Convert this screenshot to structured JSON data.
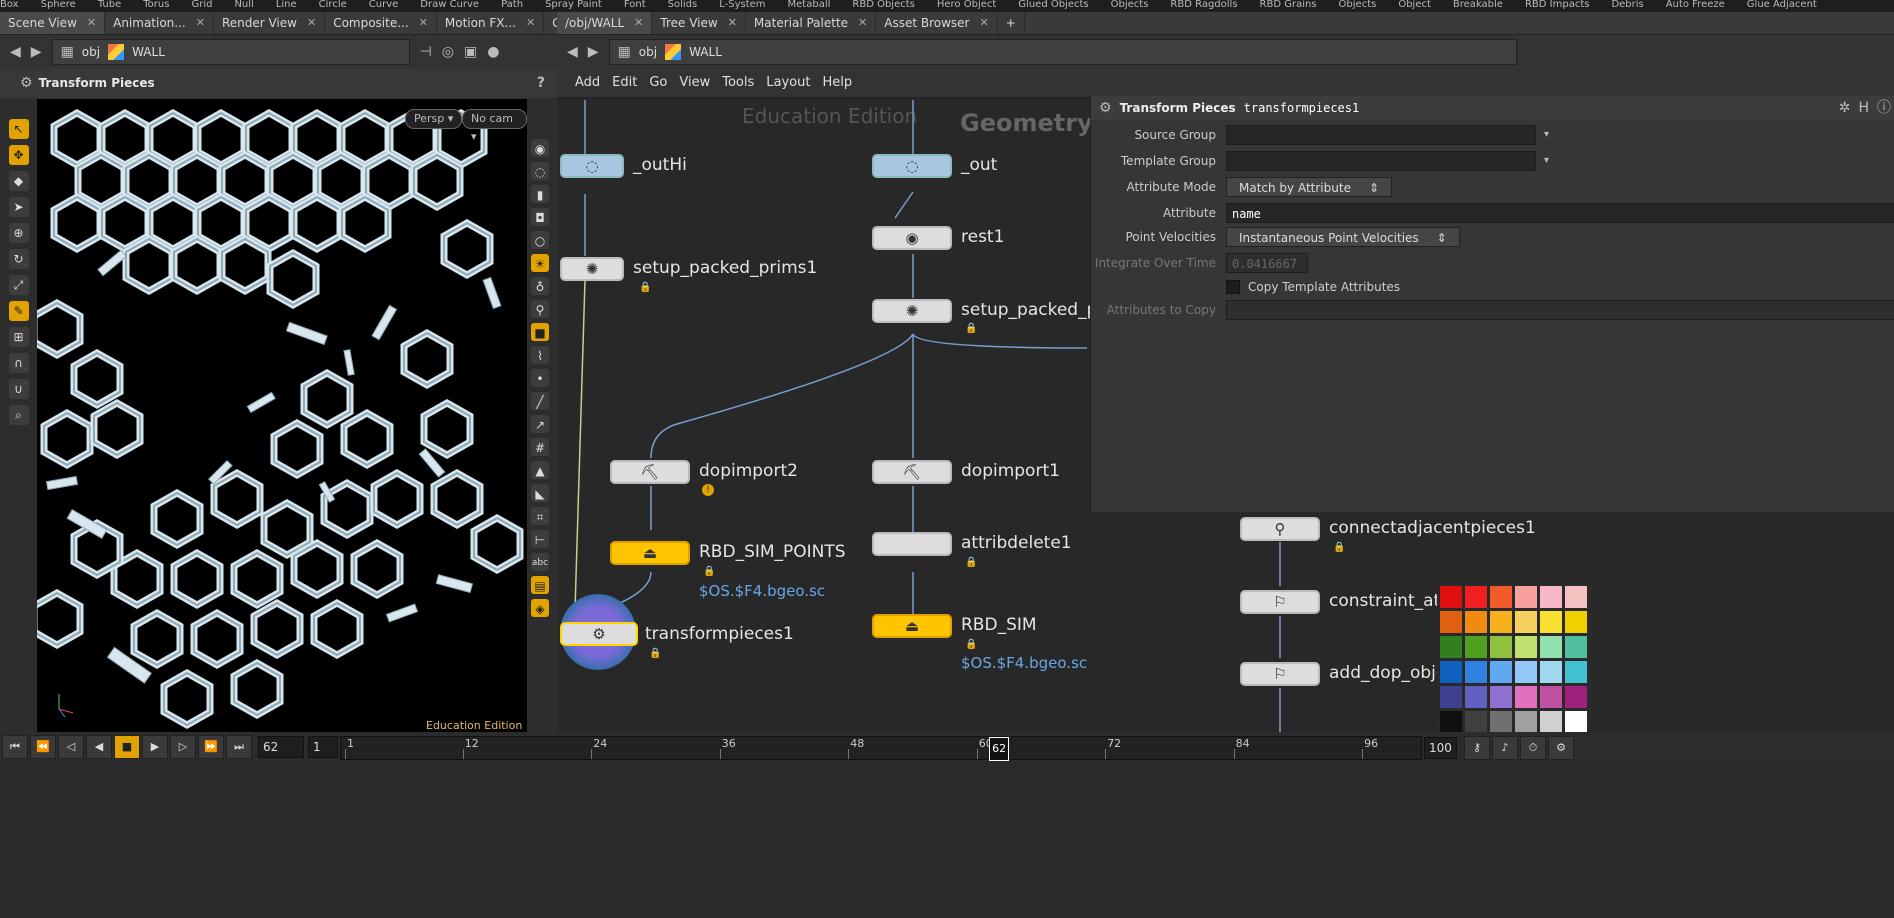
{
  "shelf": [
    "Box",
    "Sphere",
    "Tube",
    "Torus",
    "Grid",
    "Null",
    "Line",
    "Circle",
    "Curve",
    "Draw Curve",
    "Path",
    "Spray Paint",
    "Font",
    "Solids",
    "L-System",
    "Metaball",
    "RBD Objects",
    "Hero Object",
    "Glued Objects",
    "Objects",
    "RBD Ragdolls",
    "RBD Grains",
    "Objects",
    "Object",
    "Breakable",
    "RBD Impacts",
    "Debris",
    "Auto Freeze",
    "Glue Adjacent"
  ],
  "left_pane": {
    "tabs": [
      "Scene View",
      "Animation...",
      "Render View",
      "Composite...",
      "Motion FX...",
      "Geometry..."
    ],
    "path": {
      "context": "obj",
      "node": "WALL"
    },
    "header_title": "Transform Pieces",
    "persp_label": "Persp",
    "cam_label": "No cam",
    "edition": "Education Edition"
  },
  "right_pane": {
    "tabs": [
      "/obj/WALL",
      "Tree View",
      "Material Palette",
      "Asset Browser"
    ],
    "path": {
      "context": "obj",
      "node": "WALL"
    },
    "menu": [
      "Add",
      "Edit",
      "Go",
      "View",
      "Tools",
      "Layout",
      "Help"
    ],
    "watermark_edition": "Education Edition",
    "watermark_context": "Geometry"
  },
  "nodes": {
    "outhi": "_outHi",
    "out": "_out",
    "rest1": "rest1",
    "setup1": "setup_packed_prims1",
    "setup2": "setup_packed_pr",
    "dopimport2": "dopimport2",
    "dopimport1": "dopimport1",
    "rbdsimpoints": "RBD_SIM_POINTS",
    "rbdsimpoints_sub": "$OS.$F4.bgeo.sc",
    "attribdelete1": "attribdelete1",
    "transformpieces1": "transformpieces1",
    "rbdsim": "RBD_SIM",
    "rbdsim_sub": "$OS.$F4.bgeo.sc",
    "connectadjacentpieces1": "connectadjacentpieces1",
    "constraint": "constraint_att",
    "adddop": "add_dop_obje"
  },
  "parameters": {
    "node_type": "Transform Pieces",
    "node_name": "transformpieces1",
    "source_group_label": "Source Group",
    "source_group_value": "",
    "template_group_label": "Template Group",
    "template_group_value": "",
    "attribute_mode_label": "Attribute Mode",
    "attribute_mode_value": "Match by Attribute",
    "attribute_label": "Attribute",
    "attribute_value": "name",
    "point_velocities_label": "Point Velocities",
    "point_velocities_value": "Instantaneous Point Velocities",
    "integrate_label": "Integrate Over Time",
    "integrate_value": "0.0416667",
    "copy_template_label": "Copy Template Attributes",
    "attributes_to_copy_label": "Attributes to Copy"
  },
  "palette_colors": [
    "#e01010",
    "#f02020",
    "#f25a2a",
    "#f8a0a0",
    "#f8b8c8",
    "#f4c0c0",
    "#e06010",
    "#f08a10",
    "#f6b020",
    "#f8d060",
    "#f8e030",
    "#f0d000",
    "#308020",
    "#50a020",
    "#90c040",
    "#c0e070",
    "#90e0b0",
    "#50c0a0",
    "#1060c0",
    "#3080e0",
    "#60a8f0",
    "#90c8f8",
    "#a0d8f0",
    "#40c0d0",
    "#404090",
    "#6060c0",
    "#9070d0",
    "#e070c0",
    "#c050a0",
    "#a02080",
    "#101010",
    "#404040",
    "#707070",
    "#a0a0a0",
    "#d0d0d0",
    "#ffffff"
  ],
  "timeline": {
    "current_frame": "62",
    "start_frame": "1",
    "ticks": [
      "1",
      "12",
      "24",
      "36",
      "48",
      "60",
      "72",
      "84",
      "96"
    ],
    "marker": "62",
    "end_frame": "100"
  }
}
